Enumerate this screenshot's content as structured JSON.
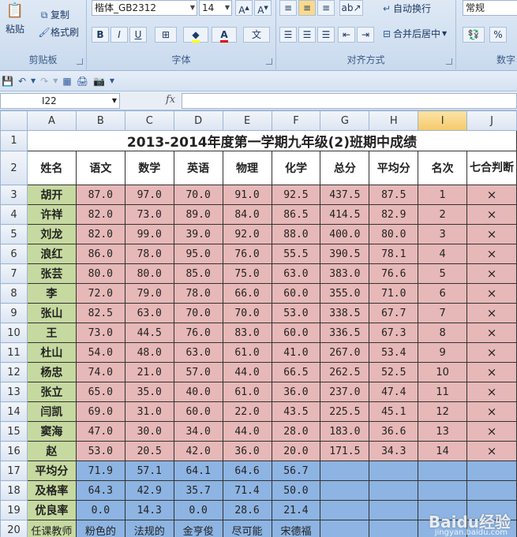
{
  "ribbon": {
    "clipboard": {
      "paste": "粘贴",
      "copy": "复制",
      "format_painter": "格式刷",
      "label": "剪贴板"
    },
    "font": {
      "font_name": "楷体_GB2312",
      "font_size": "14",
      "label": "字体",
      "bold": "B",
      "italic": "I",
      "underline": "U",
      "font_color_letter": "A",
      "phonetic": "文"
    },
    "alignment": {
      "wrap_text": "自动换行",
      "merge_center": "合并后居中",
      "label": "对齐方式"
    },
    "number": {
      "format": "常规",
      "percent": "%",
      "label": "数字"
    }
  },
  "formula_bar": {
    "name_box": "I22",
    "fx": "fx",
    "formula": ""
  },
  "columns": [
    "A",
    "B",
    "C",
    "D",
    "E",
    "F",
    "G",
    "H",
    "I",
    "J"
  ],
  "selected_column": "I",
  "rows": [
    "1",
    "2",
    "3",
    "4",
    "5",
    "6",
    "7",
    "8",
    "9",
    "10",
    "11",
    "12",
    "13",
    "14",
    "15",
    "16",
    "17",
    "18",
    "19",
    "20"
  ],
  "sheet": {
    "title": "2013-2014年度第一学期九年级(2)班期中成绩",
    "headers": [
      "姓名",
      "语文",
      "数学",
      "英语",
      "物理",
      "化学",
      "总分",
      "平均分",
      "名次",
      "七合判断"
    ],
    "students": [
      [
        "胡开",
        "87.0",
        "97.0",
        "70.0",
        "91.0",
        "92.5",
        "437.5",
        "87.5",
        "1",
        "×"
      ],
      [
        "许祥",
        "82.0",
        "73.0",
        "89.0",
        "84.0",
        "86.5",
        "414.5",
        "82.9",
        "2",
        "×"
      ],
      [
        "刘龙",
        "82.0",
        "99.0",
        "39.0",
        "92.0",
        "88.0",
        "400.0",
        "80.0",
        "3",
        "×"
      ],
      [
        "浪红",
        "86.0",
        "78.0",
        "95.0",
        "76.0",
        "55.5",
        "390.5",
        "78.1",
        "4",
        "×"
      ],
      [
        "张芸",
        "80.0",
        "80.0",
        "85.0",
        "75.0",
        "63.0",
        "383.0",
        "76.6",
        "5",
        "×"
      ],
      [
        "李",
        "72.0",
        "79.0",
        "78.0",
        "66.0",
        "60.0",
        "355.0",
        "71.0",
        "6",
        "×"
      ],
      [
        "张山",
        "82.5",
        "63.0",
        "70.0",
        "70.0",
        "53.0",
        "338.5",
        "67.7",
        "7",
        "×"
      ],
      [
        "王",
        "73.0",
        "44.5",
        "76.0",
        "83.0",
        "60.0",
        "336.5",
        "67.3",
        "8",
        "×"
      ],
      [
        "杜山",
        "54.0",
        "48.0",
        "63.0",
        "61.0",
        "41.0",
        "267.0",
        "53.4",
        "9",
        "×"
      ],
      [
        "杨忠",
        "74.0",
        "21.0",
        "57.0",
        "44.0",
        "66.5",
        "262.5",
        "52.5",
        "10",
        "×"
      ],
      [
        "张立",
        "65.0",
        "35.0",
        "40.0",
        "61.0",
        "36.0",
        "237.0",
        "47.4",
        "11",
        "×"
      ],
      [
        "闫凯",
        "69.0",
        "31.0",
        "60.0",
        "22.0",
        "43.5",
        "225.5",
        "45.1",
        "12",
        "×"
      ],
      [
        "窦海",
        "47.0",
        "30.0",
        "34.0",
        "44.0",
        "28.0",
        "183.0",
        "36.6",
        "13",
        "×"
      ],
      [
        "赵",
        "53.0",
        "20.5",
        "42.0",
        "36.0",
        "20.0",
        "171.5",
        "34.3",
        "14",
        "×"
      ]
    ],
    "summary": [
      [
        "平均分",
        "71.9",
        "57.1",
        "64.1",
        "64.6",
        "56.7"
      ],
      [
        "及格率",
        "64.3",
        "42.9",
        "35.7",
        "71.4",
        "50.0"
      ],
      [
        "优良率",
        "0.0",
        "14.3",
        "0.0",
        "28.6",
        "21.4"
      ]
    ],
    "teachers": [
      "任课教师",
      "粉色的",
      "法规的",
      "金亨俊",
      "尽可能",
      "宋德福"
    ]
  },
  "watermark": {
    "brand": "Baidu经验",
    "url": "jingyan.baidu.com"
  }
}
